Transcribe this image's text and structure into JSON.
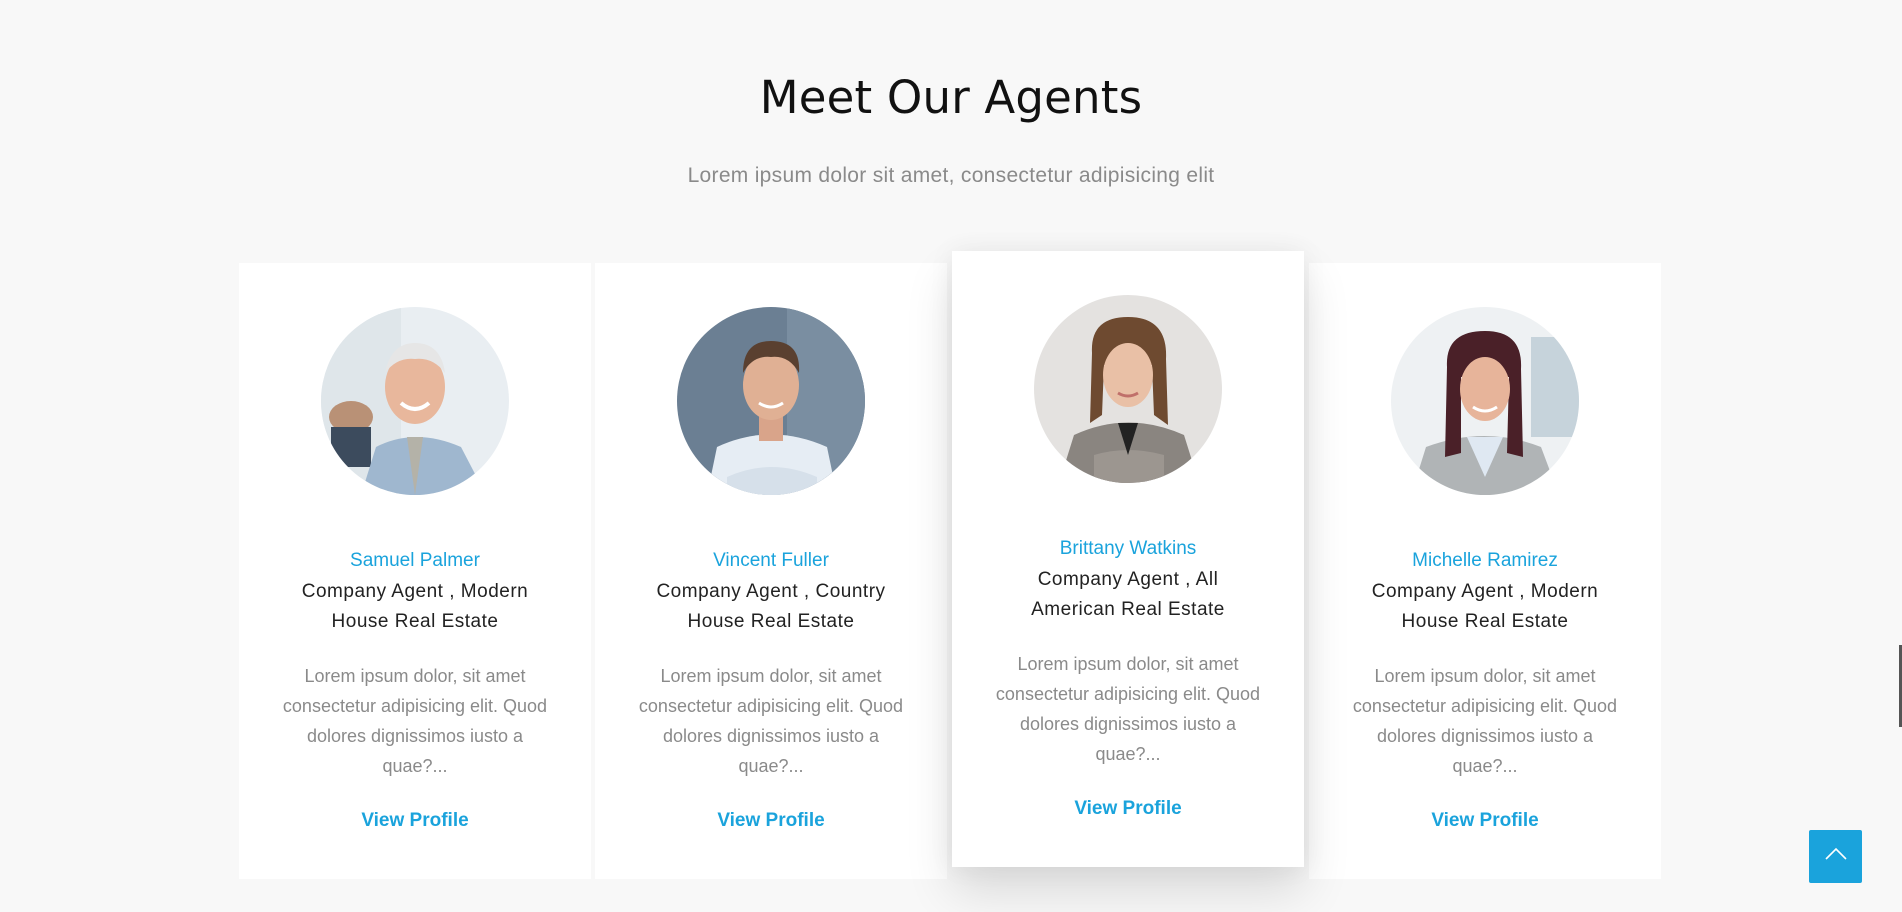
{
  "section": {
    "title": "Meet Our Agents",
    "subtitle": "Lorem ipsum dolor sit amet, consectetur adipisicing elit"
  },
  "agents": [
    {
      "name": "Samuel Palmer",
      "role": "Company Agent , Modern House Real Estate",
      "description": "Lorem ipsum dolor, sit amet consectetur adipisicing elit. Quod dolores dignissimos iusto a quae?...",
      "link_label": "View Profile"
    },
    {
      "name": "Vincent Fuller",
      "role": "Company Agent , Country House Real Estate",
      "description": "Lorem ipsum dolor, sit amet consectetur adipisicing elit. Quod dolores dignissimos iusto a quae?...",
      "link_label": "View Profile"
    },
    {
      "name": "Brittany Watkins",
      "role": "Company Agent , All American Real Estate",
      "description": "Lorem ipsum dolor, sit amet consectetur adipisicing elit. Quod dolores dignissimos iusto a quae?...",
      "link_label": "View Profile"
    },
    {
      "name": "Michelle Ramirez",
      "role": "Company Agent , Modern House Real Estate",
      "description": "Lorem ipsum dolor, sit amet consectetur adipisicing elit. Quod dolores dignissimos iusto a quae?...",
      "link_label": "View Profile"
    }
  ],
  "scroll_top": {
    "icon": "chevron-up-icon"
  },
  "colors": {
    "accent": "#1aa3dc",
    "background": "#f8f8f8",
    "card": "#ffffff",
    "muted_text": "#8a8a8a",
    "dark_text": "#222222"
  }
}
